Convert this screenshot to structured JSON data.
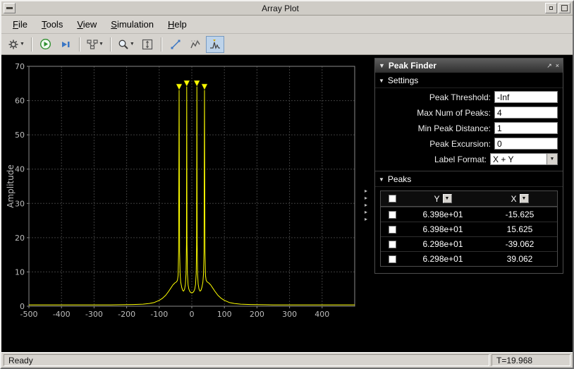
{
  "window": {
    "title": "Array Plot"
  },
  "titlebar": {
    "buttons": [
      "window-menu",
      "minimize",
      "maximize"
    ]
  },
  "menu": {
    "items": [
      "File",
      "Tools",
      "View",
      "Simulation",
      "Help"
    ]
  },
  "toolbar": {
    "buttons": [
      {
        "name": "settings",
        "icon": "gear-icon",
        "dropdown": true
      },
      {
        "name": "run",
        "icon": "run-icon"
      },
      {
        "name": "step-forward",
        "icon": "step-forward-icon"
      },
      {
        "name": "simulation-options",
        "icon": "signal-routing-icon",
        "dropdown": true
      },
      {
        "name": "zoom",
        "icon": "magnifier-icon",
        "dropdown": true
      },
      {
        "name": "fit-to-view",
        "icon": "fit-to-view-icon"
      },
      {
        "name": "measurements",
        "icon": "cursor-measurements-icon"
      },
      {
        "name": "signal-statistics",
        "icon": "signal-statistics-icon"
      },
      {
        "name": "peak-finder",
        "icon": "peak-finder-icon",
        "active": true
      }
    ]
  },
  "panel": {
    "title": "Peak Finder",
    "header_icons": [
      "collapse-icon",
      "dock-icon",
      "close-icon"
    ],
    "settings_section": "Settings",
    "peaks_section": "Peaks",
    "fields": [
      {
        "name": "peak-threshold",
        "label": "Peak Threshold:",
        "value": "-Inf",
        "type": "text"
      },
      {
        "name": "max-num-peaks",
        "label": "Max Num of Peaks:",
        "value": "4",
        "type": "text"
      },
      {
        "name": "min-peak-distance",
        "label": "Min Peak Distance:",
        "value": "1",
        "type": "text"
      },
      {
        "name": "peak-excursion",
        "label": "Peak Excursion:",
        "value": "0",
        "type": "text"
      },
      {
        "name": "label-format",
        "label": "Label Format:",
        "value": "X + Y",
        "type": "select"
      }
    ],
    "table": {
      "columns": [
        "Y",
        "X"
      ],
      "rows": [
        {
          "y": "6.398e+01",
          "x": "-15.625"
        },
        {
          "y": "6.398e+01",
          "x": "15.625"
        },
        {
          "y": "6.298e+01",
          "x": "-39.062"
        },
        {
          "y": "6.298e+01",
          "x": "39.062"
        }
      ]
    }
  },
  "statusbar": {
    "left": "Ready",
    "right": "T=19.968"
  },
  "chart_data": {
    "type": "line",
    "title": "",
    "xlabel": "",
    "ylabel": "Amplitude",
    "xlim": [
      -500,
      500
    ],
    "ylim": [
      0,
      70
    ],
    "xticks": [
      -500,
      -400,
      -300,
      -200,
      -100,
      0,
      100,
      200,
      300,
      400
    ],
    "yticks": [
      0,
      10,
      20,
      30,
      40,
      50,
      60,
      70
    ],
    "grid": true,
    "line_color": "#ffff00",
    "background": "#000000",
    "peak_markers": [
      {
        "x": -15.625,
        "y": 63.98
      },
      {
        "x": 15.625,
        "y": 63.98
      },
      {
        "x": -39.062,
        "y": 62.98
      },
      {
        "x": 39.062,
        "y": 62.98
      }
    ],
    "signal": [
      [
        -500,
        0.4
      ],
      [
        -250,
        0.4
      ],
      [
        -180,
        0.5
      ],
      [
        -150,
        0.6
      ],
      [
        -130,
        0.8
      ],
      [
        -115,
        1.1
      ],
      [
        -100,
        1.7
      ],
      [
        -90,
        2.3
      ],
      [
        -80,
        3.2
      ],
      [
        -72,
        4.2
      ],
      [
        -65,
        5.2
      ],
      [
        -58,
        6.2
      ],
      [
        -52,
        6.8
      ],
      [
        -47,
        7.1
      ],
      [
        -44,
        7.6
      ],
      [
        -42,
        9
      ],
      [
        -40.5,
        16
      ],
      [
        -39.06,
        63
      ],
      [
        -37.5,
        16
      ],
      [
        -36,
        9.5
      ],
      [
        -34,
        7
      ],
      [
        -31,
        5.5
      ],
      [
        -28,
        4.6
      ],
      [
        -25,
        4.4
      ],
      [
        -22,
        5
      ],
      [
        -19.5,
        6.5
      ],
      [
        -17.8,
        9.5
      ],
      [
        -16.5,
        18
      ],
      [
        -15.63,
        64
      ],
      [
        -14.8,
        18
      ],
      [
        -13.5,
        9.5
      ],
      [
        -11.5,
        6.3
      ],
      [
        -9,
        5
      ],
      [
        -6,
        4.3
      ],
      [
        -3,
        4
      ],
      [
        0,
        3.9
      ],
      [
        3,
        4
      ],
      [
        6,
        4.3
      ],
      [
        9,
        5
      ],
      [
        11.5,
        6.3
      ],
      [
        13.5,
        9.5
      ],
      [
        14.8,
        18
      ],
      [
        15.63,
        64
      ],
      [
        16.5,
        18
      ],
      [
        17.8,
        9.5
      ],
      [
        19.5,
        6.5
      ],
      [
        22,
        5
      ],
      [
        25,
        4.4
      ],
      [
        28,
        4.6
      ],
      [
        31,
        5.5
      ],
      [
        34,
        7
      ],
      [
        36,
        9.5
      ],
      [
        37.5,
        16
      ],
      [
        39.06,
        63
      ],
      [
        40.5,
        16
      ],
      [
        42,
        9
      ],
      [
        44,
        7.6
      ],
      [
        47,
        7.1
      ],
      [
        52,
        6.8
      ],
      [
        58,
        6.2
      ],
      [
        65,
        5.2
      ],
      [
        72,
        4.2
      ],
      [
        80,
        3.2
      ],
      [
        90,
        2.3
      ],
      [
        100,
        1.7
      ],
      [
        115,
        1.1
      ],
      [
        130,
        0.8
      ],
      [
        150,
        0.6
      ],
      [
        180,
        0.5
      ],
      [
        250,
        0.4
      ],
      [
        500,
        0.4
      ]
    ]
  }
}
